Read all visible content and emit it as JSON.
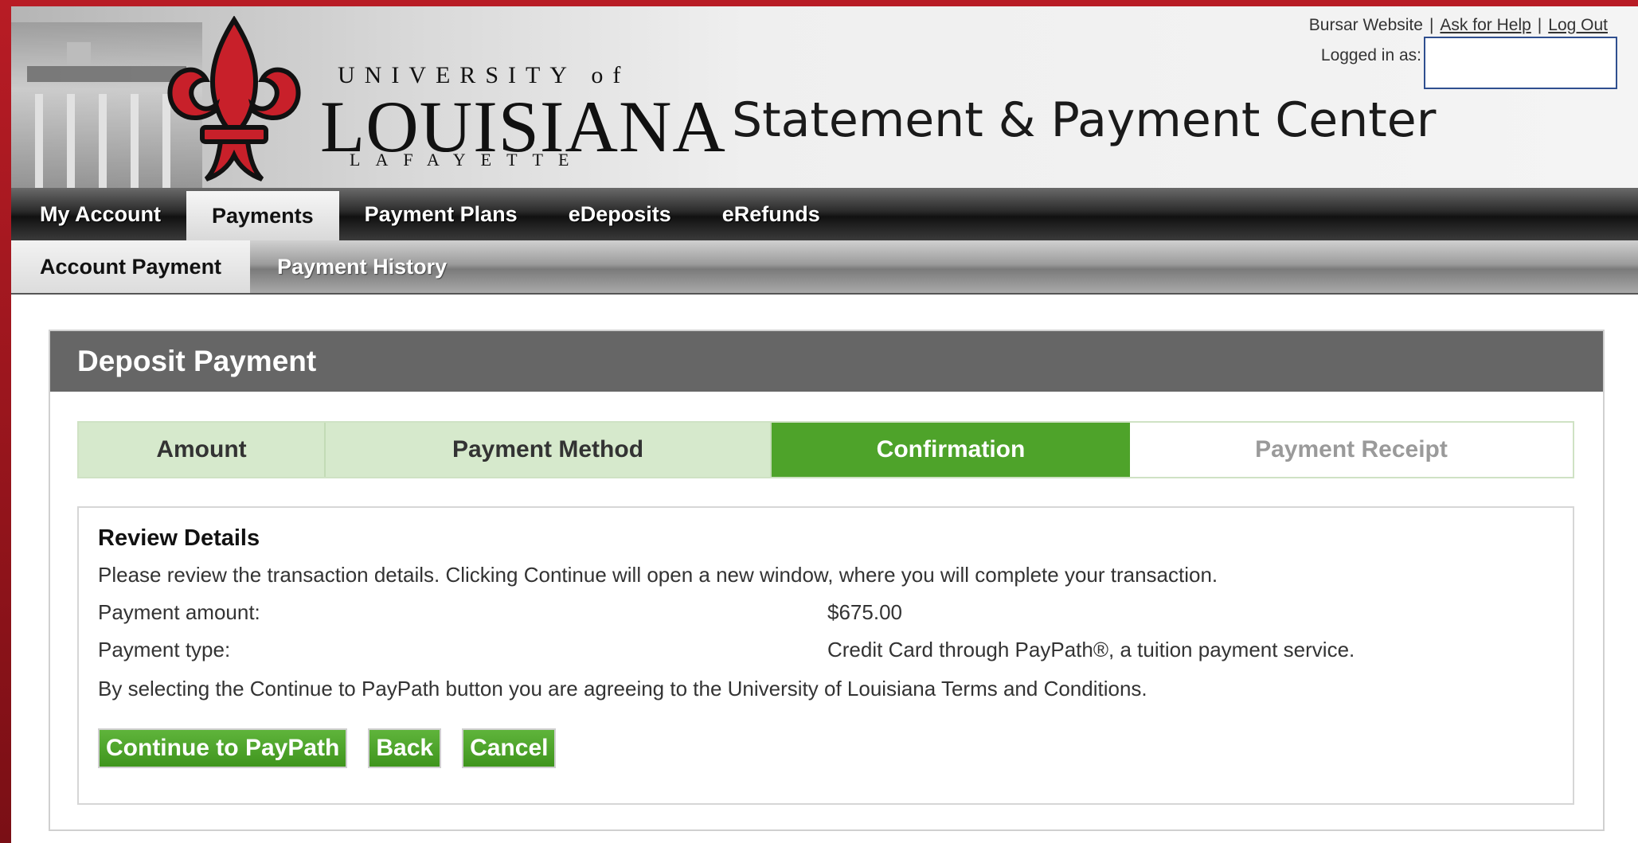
{
  "header": {
    "logo": {
      "line1": "UNIVERSITY of",
      "line2": "LOUISIANA",
      "line3": "LAFAYETTE"
    },
    "site_title": "Statement & Payment Center",
    "top_links": [
      "Bursar Website",
      "Ask for Help",
      "Log Out"
    ],
    "logged_in_label": "Logged in as:"
  },
  "nav_primary": [
    {
      "label": "My Account"
    },
    {
      "label": "Payments"
    },
    {
      "label": "Payment Plans"
    },
    {
      "label": "eDeposits"
    },
    {
      "label": "eRefunds"
    }
  ],
  "nav_primary_active": "Payments",
  "nav_secondary": [
    {
      "label": "Account Payment"
    },
    {
      "label": "Payment History"
    }
  ],
  "nav_secondary_active": "Account Payment",
  "panel": {
    "title": "Deposit Payment",
    "steps": [
      {
        "label": "Amount",
        "state": "done"
      },
      {
        "label": "Payment Method",
        "state": "done"
      },
      {
        "label": "Confirmation",
        "state": "current"
      },
      {
        "label": "Payment Receipt",
        "state": "future"
      }
    ],
    "review": {
      "heading": "Review Details",
      "intro": "Please review the transaction details. Clicking Continue will open a new window, where you will complete your transaction.",
      "amount_label": "Payment amount:",
      "amount_value": "$675.00",
      "type_label": "Payment type:",
      "type_value": "Credit Card through PayPath®, a tuition payment service.",
      "terms": "By selecting the Continue to PayPath button you are agreeing to the University of Louisiana Terms and Conditions."
    },
    "buttons": {
      "continue": "Continue to PayPath",
      "back": "Back",
      "cancel": "Cancel"
    }
  },
  "colors": {
    "brand_red": "#b81c25",
    "step_current": "#4ea32a",
    "step_done": "#d6e9cc",
    "panel_header": "#666666"
  }
}
